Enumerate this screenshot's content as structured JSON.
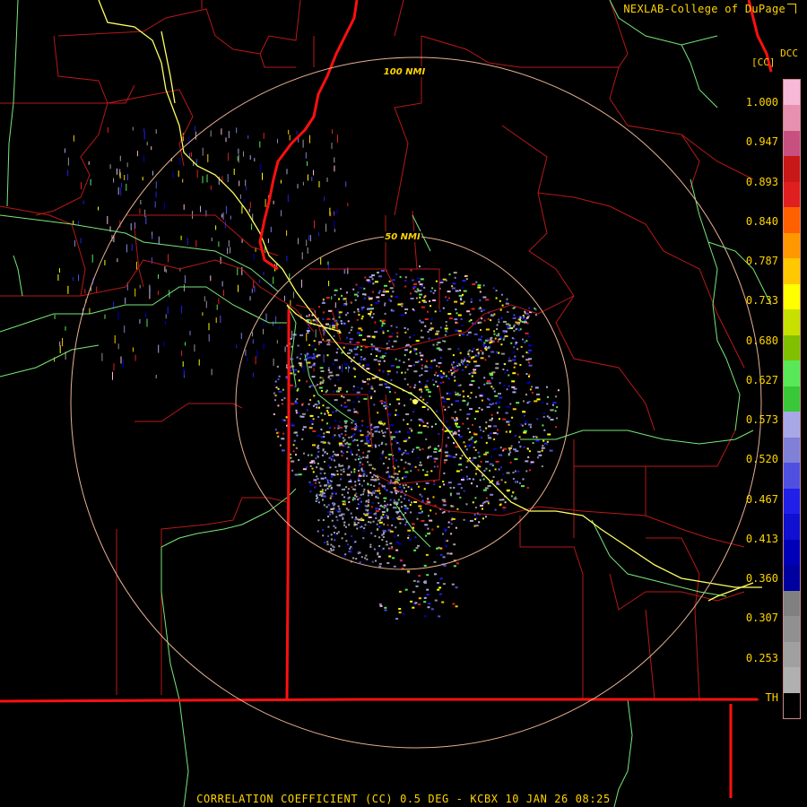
{
  "header": {
    "credit": "NEXLAB-College of DuPage",
    "product_tag": "DCC"
  },
  "legend": {
    "unit": "[CC]",
    "ticks": [
      "1.000",
      "0.947",
      "0.893",
      "0.840",
      "0.787",
      "0.733",
      "0.680",
      "0.627",
      "0.573",
      "0.520",
      "0.467",
      "0.413",
      "0.360",
      "0.307",
      "0.253",
      "TH"
    ],
    "colors": [
      "#f8b8d8",
      "#e890b0",
      "#c85080",
      "#c81818",
      "#e02020",
      "#ff6000",
      "#ff9800",
      "#ffc800",
      "#ffff00",
      "#c8e000",
      "#80c000",
      "#58e858",
      "#38c838",
      "#a8a8e8",
      "#8080d8",
      "#5050e0",
      "#2020e8",
      "#1010d0",
      "#0000b8",
      "#0000a0",
      "#808080",
      "#909090",
      "#a0a0a0",
      "#b0b0b0",
      "#000000"
    ]
  },
  "rings": [
    {
      "label": "100 NMI"
    },
    {
      "label": "50 NMI"
    }
  ],
  "footer": {
    "caption": "CORRELATION COEFFICIENT (CC) 0.5 DEG - KCBX 10 JAN 26 08:25"
  },
  "colors": {
    "state_border": "#ff1010",
    "county_border": "#b81818",
    "highway": "#ffff60",
    "river": "#78e878",
    "range_ring": "#e8b090",
    "text": "#ffd400"
  }
}
